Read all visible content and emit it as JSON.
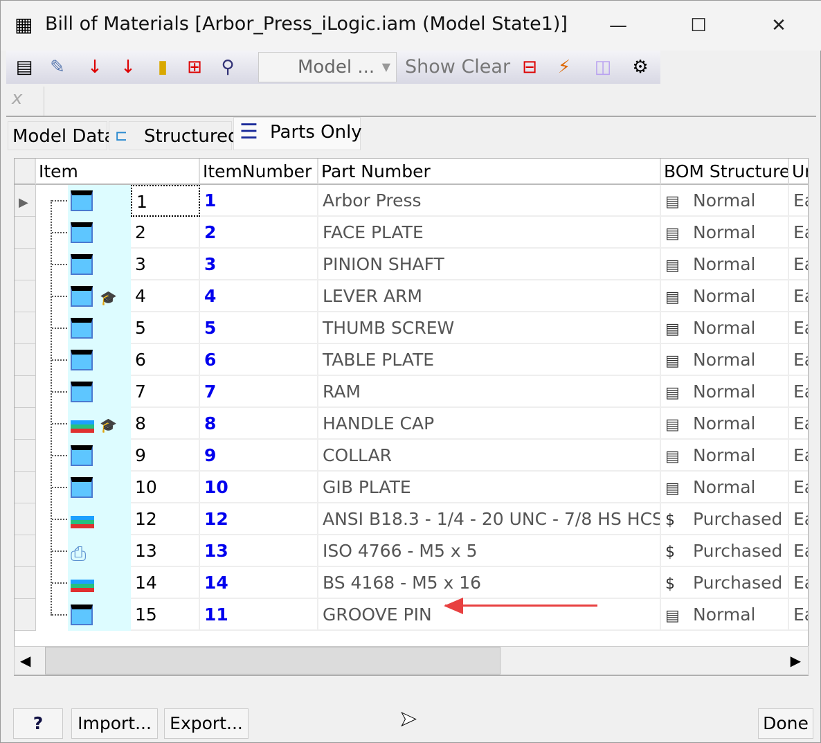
{
  "window": {
    "title": "Bill of Materials [Arbor_Press_iLogic.iam (Model State1)]",
    "minimize": "—",
    "maximize": "☐",
    "close": "✕"
  },
  "toolbar": {
    "icons": [
      "export-table-icon",
      "edit-icon",
      "sort-alpha-icon",
      "sort-numeric-icon",
      "insert-icon",
      "renumber-icon",
      "find-icon",
      "view-options-icon",
      "mass-icon",
      "add-component-icon",
      "gear-icon"
    ],
    "model_select": "Model ...",
    "show_label": "Show",
    "clear_label": "Clear"
  },
  "tabs": [
    {
      "label": "Model Data"
    },
    {
      "label": "Structured"
    },
    {
      "label": "Parts Only",
      "active": true
    }
  ],
  "columns": [
    "Item",
    "ItemNumber",
    "Part Number",
    "BOM Structure",
    "Unit"
  ],
  "rows": [
    {
      "item": "1",
      "num": "1",
      "part": "Arbor Press",
      "bom": "Normal",
      "unit": "Each",
      "icon": "part",
      "extra": false
    },
    {
      "item": "2",
      "num": "2",
      "part": "FACE PLATE",
      "bom": "Normal",
      "unit": "Each",
      "icon": "part",
      "extra": false
    },
    {
      "item": "3",
      "num": "3",
      "part": "PINION SHAFT",
      "bom": "Normal",
      "unit": "Each",
      "icon": "part",
      "extra": false
    },
    {
      "item": "4",
      "num": "4",
      "part": "LEVER ARM",
      "bom": "Normal",
      "unit": "Each",
      "icon": "part",
      "extra": true
    },
    {
      "item": "5",
      "num": "5",
      "part": "THUMB SCREW",
      "bom": "Normal",
      "unit": "Each",
      "icon": "part",
      "extra": false
    },
    {
      "item": "6",
      "num": "6",
      "part": "TABLE PLATE",
      "bom": "Normal",
      "unit": "Each",
      "icon": "part",
      "extra": false
    },
    {
      "item": "7",
      "num": "7",
      "part": "RAM",
      "bom": "Normal",
      "unit": "Each",
      "icon": "part",
      "extra": false
    },
    {
      "item": "8",
      "num": "8",
      "part": "HANDLE CAP",
      "bom": "Normal",
      "unit": "Each",
      "icon": "stack",
      "extra": true
    },
    {
      "item": "9",
      "num": "9",
      "part": "COLLAR",
      "bom": "Normal",
      "unit": "Each",
      "icon": "part",
      "extra": false
    },
    {
      "item": "10",
      "num": "10",
      "part": "GIB PLATE",
      "bom": "Normal",
      "unit": "Each",
      "icon": "part",
      "extra": false
    },
    {
      "item": "12",
      "num": "12",
      "part": "ANSI B18.3 - 1/4 - 20 UNC - 7/8 HS HCS",
      "bom": "Purchased",
      "unit": "Each",
      "icon": "stack",
      "extra": false
    },
    {
      "item": "13",
      "num": "13",
      "part": "ISO 4766 - M5 x 5",
      "bom": "Purchased",
      "unit": "Each",
      "icon": "content",
      "extra": false
    },
    {
      "item": "14",
      "num": "14",
      "part": "BS 4168 - M5 x 16",
      "bom": "Purchased",
      "unit": "Each",
      "icon": "stack",
      "extra": false
    },
    {
      "item": "15",
      "num": "11",
      "part": "GROOVE PIN",
      "bom": "Normal",
      "unit": "Each",
      "icon": "part",
      "extra": false
    }
  ],
  "footer": {
    "help": "?",
    "import": "Import...",
    "export": "Export...",
    "done": "Done"
  },
  "colors": {
    "item_number": "#0000ee",
    "icon_bg": "#ddfcff",
    "arrow": "#e84040"
  }
}
